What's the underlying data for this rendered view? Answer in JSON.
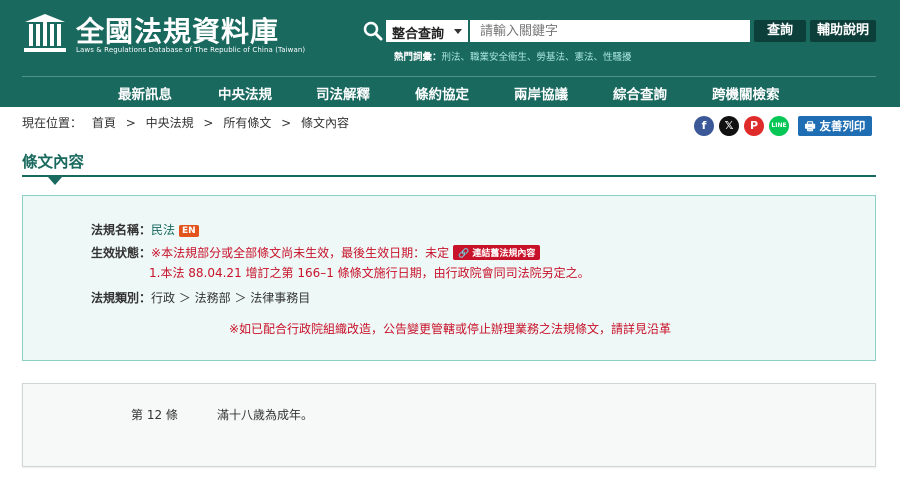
{
  "header": {
    "site_title": "全國法規資料庫",
    "site_subtitle": "Laws & Regulations Database of The Republic of China (Taiwan)",
    "search_select": "整合查詢",
    "search_placeholder": "請輸入關鍵字",
    "search_button": "查詢",
    "help_button": "輔助說明",
    "hot_label": "熱門詞彙：",
    "hot_keywords": "刑法、職業安全衛生、勞基法、憲法、性騷擾"
  },
  "nav": [
    "最新訊息",
    "中央法規",
    "司法解釋",
    "條約協定",
    "兩岸協議",
    "綜合查詢",
    "跨機關檢索"
  ],
  "breadcrumb": {
    "label": "現在位置：",
    "items": [
      "首頁",
      "中央法規",
      "所有條文",
      "條文內容"
    ],
    "sep": ">"
  },
  "share": {
    "facebook": "f",
    "x": "𝕏",
    "plurk": "P",
    "line": "LINE",
    "print": "友善列印"
  },
  "page_title": "條文內容",
  "info": {
    "law_name_label": "法規名稱：",
    "law_name": "民法",
    "en_badge": "EN",
    "status_label": "生效狀態：",
    "status_text": "※本法規部分或全部條文尚未生效，最後生效日期：未定",
    "status_badge": "連結舊法規內容",
    "status_note": "1.本法 88.04.21 增訂之第 166–1  條條文施行日期，由行政院會同司法院另定之。",
    "category_label": "法規類別：",
    "category": "行政 ＞ 法務部 ＞ 法律事務目",
    "notice": "※如已配合行政院組織改造，公告變更管轄或停止辦理業務之法規條文，請詳見沿革"
  },
  "article": {
    "number": "第 12 條",
    "text": "滿十八歲為成年。"
  },
  "colors": {
    "brand": "#19695f",
    "nav_dark": "#0d3f3a",
    "alert": "#c8122a",
    "facebook": "#3b5998",
    "x": "#111111",
    "plurk": "#e02b2b",
    "line": "#06c755",
    "print": "#1f6db3"
  }
}
